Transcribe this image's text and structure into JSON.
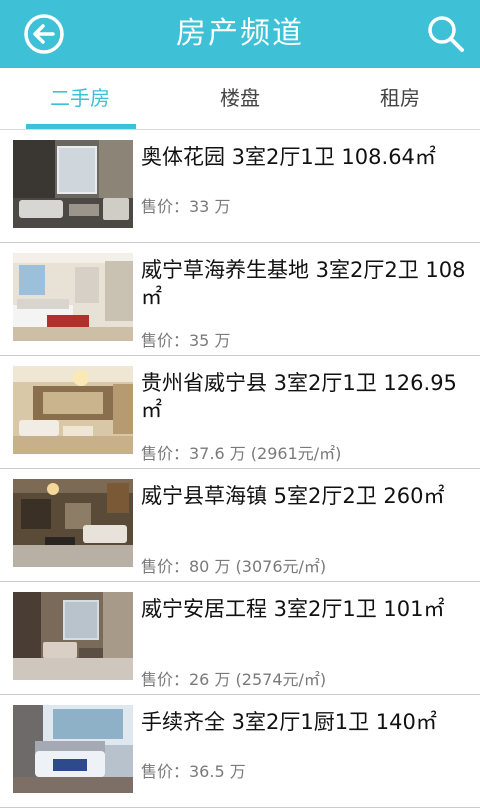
{
  "header": {
    "title": "房产频道",
    "back_icon": "back-arrow-icon",
    "search_icon": "search-icon",
    "background": "#3ec0d6"
  },
  "tabs": [
    {
      "label": "二手房",
      "active": true
    },
    {
      "label": "楼盘",
      "active": false
    },
    {
      "label": "租房",
      "active": false
    }
  ],
  "listings": [
    {
      "title": "奥体花园 3室2厅1卫 108.64㎡",
      "price": "售价：33 万"
    },
    {
      "title": "威宁草海养生基地 3室2厅2卫 108㎡",
      "price": "售价：35 万"
    },
    {
      "title": "贵州省威宁县 3室2厅1卫 126.95㎡",
      "price": "售价：37.6 万 (2961元/㎡)"
    },
    {
      "title": "威宁县草海镇 5室2厅2卫 260㎡",
      "price": "售价：80 万 (3076元/㎡)"
    },
    {
      "title": "威宁安居工程 3室2厅1卫 101㎡",
      "price": "售价：26 万 (2574元/㎡)"
    },
    {
      "title": "手续齐全 3室2厅1厨1卫 140㎡",
      "price": "售价：36.5 万"
    }
  ]
}
